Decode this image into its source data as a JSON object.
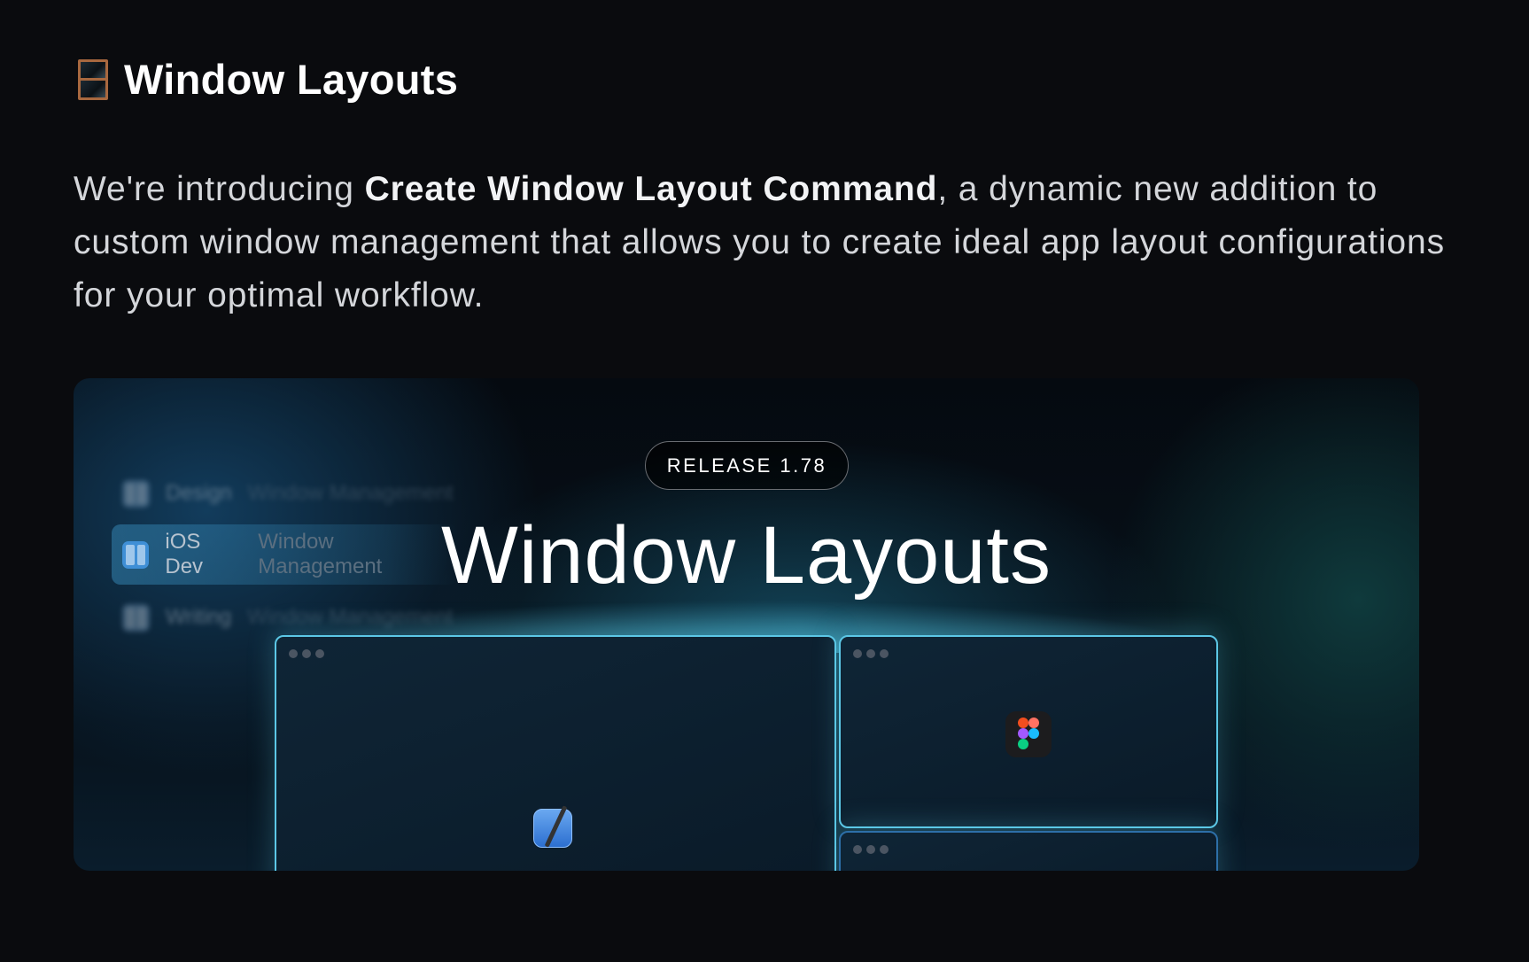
{
  "heading": {
    "icon": "window-emoji",
    "title": "Window Layouts"
  },
  "intro": {
    "before": "We're introducing ",
    "bold": "Create Window Layout Command",
    "after": ", a dynamic new addition to custom window management that allows you to create ideal app layout configurations for your optimal workflow."
  },
  "hero": {
    "badge": "RELEASE 1.78",
    "title": "Window Layouts",
    "layouts": [
      {
        "name": "Design",
        "subtitle": "Window Management"
      },
      {
        "name": "iOS Dev",
        "subtitle": "Window Management"
      },
      {
        "name": "Writing",
        "subtitle": "Window Management"
      }
    ],
    "apps": [
      "xcode-icon",
      "figma-icon"
    ],
    "accent": "#5cc7e6"
  }
}
